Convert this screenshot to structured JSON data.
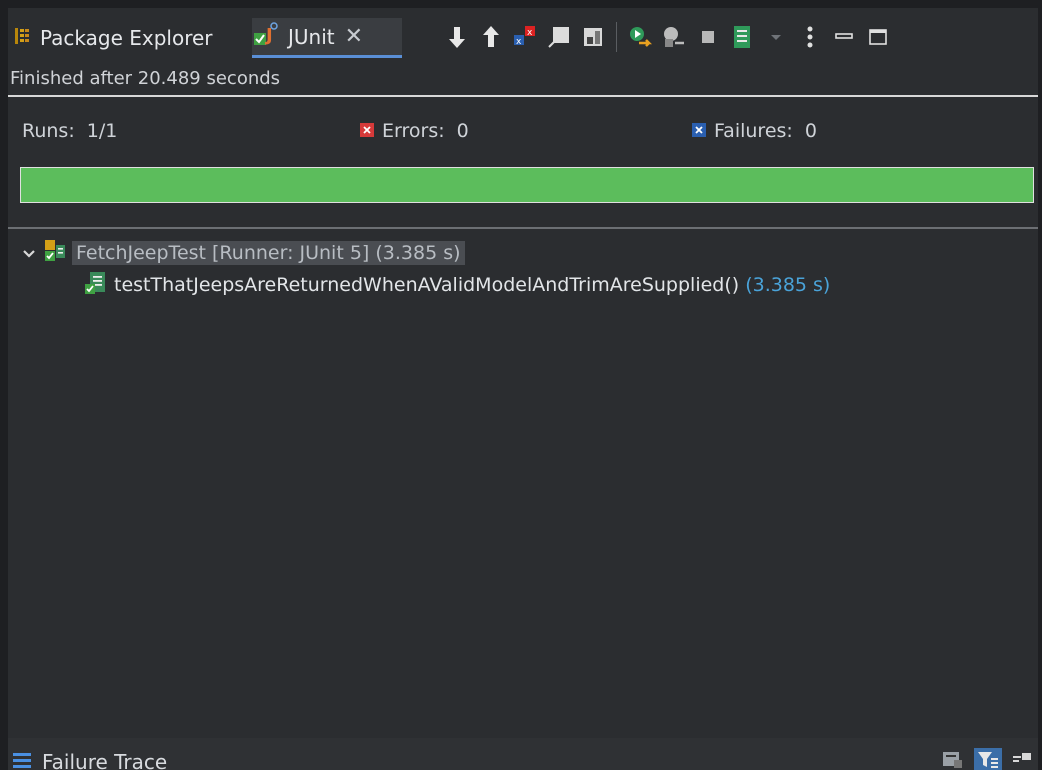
{
  "tabs": [
    {
      "label": "Package Explorer"
    },
    {
      "label": "JUnit"
    }
  ],
  "toolbar": {
    "icons": [
      "next-failure-icon",
      "previous-failure-icon",
      "show-failures-only-icon",
      "scroll-lock-icon",
      "show-skipped-icon",
      "rerun-test-icon",
      "rerun-failures-first-icon",
      "stop-icon",
      "test-run-history-icon",
      "view-menu-icon",
      "minimize-icon",
      "maximize-icon"
    ]
  },
  "status": {
    "text": "Finished after 20.489 seconds"
  },
  "counters": {
    "runs_label": "Runs:",
    "runs_value": "1/1",
    "errors_label": "Errors:",
    "errors_value": "0",
    "failures_label": "Failures:",
    "failures_value": "0"
  },
  "progress": {
    "fraction": 1.0,
    "color": "#5cbd5c"
  },
  "tree": {
    "suite": {
      "label": "FetchJeepTest [Runner: JUnit 5] (3.385 s)"
    },
    "cases": [
      {
        "name": "testThatJeepsAreReturnedWhenAValidModelAndTrimAreSupplied()",
        "time": "(3.385 s)"
      }
    ]
  },
  "footer": {
    "title": "Failure Trace"
  },
  "colors": {
    "accent": "#5a8fd6",
    "time": "#4aa3d9",
    "pass": "#5cbd5c"
  }
}
